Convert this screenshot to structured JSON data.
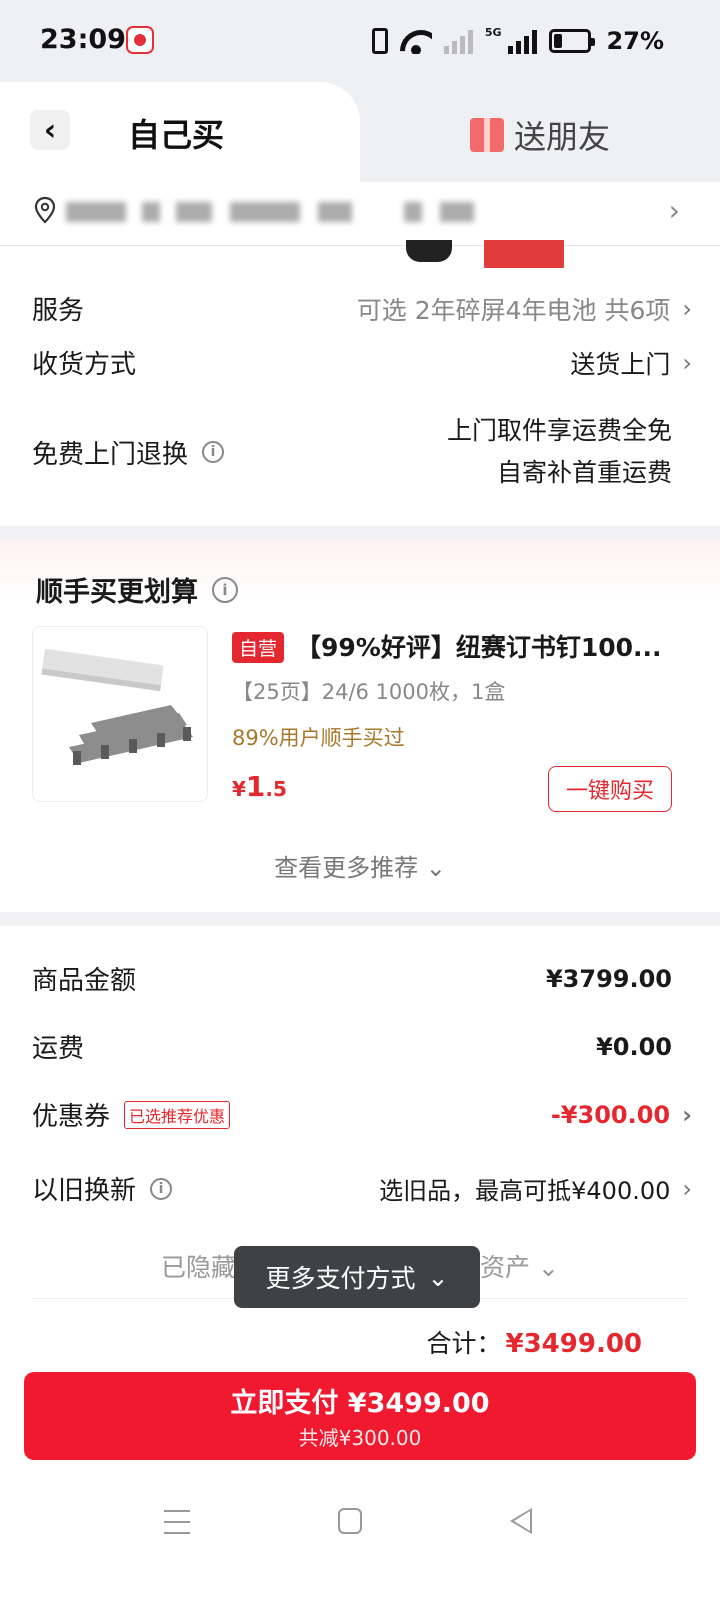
{
  "status_bar": {
    "time": "23:09",
    "network": "5G",
    "battery": "27%"
  },
  "header": {
    "tab_self": "自己买",
    "tab_gift": "送朋友"
  },
  "details": {
    "service_label": "服务",
    "service_value": "可选 2年碎屏4年电池 共6项",
    "delivery_label": "收货方式",
    "delivery_value": "送货上门",
    "return_label": "免费上门退换",
    "return_value_1": "上门取件享运费全免",
    "return_value_2": "自寄补首重运费"
  },
  "recommend": {
    "title": "顺手买更划算",
    "self_tag": "自营",
    "product_name": "【99%好评】纽赛订书钉100...",
    "spec": "【25页】24/6 1000枚，1盒",
    "hint": "89%用户顺手买过",
    "price_currency": "¥",
    "price_int": "1",
    "price_dec": ".5",
    "buy_button": "一键购买",
    "more": "查看更多推荐"
  },
  "summary": {
    "goods_label": "商品金额",
    "goods_value": "¥3799.00",
    "shipping_label": "运费",
    "shipping_value": "¥0.00",
    "coupon_label": "优惠券",
    "coupon_tag": "已选推荐优惠",
    "coupon_value": "-¥300.00",
    "tradein_label": "以旧换新",
    "tradein_value": "选旧品，最高可抵¥400.00",
    "hidden_left": "已隐藏",
    "hidden_right": "资产",
    "total_label": "合计：",
    "total_value": "¥3499.00"
  },
  "toast": {
    "text": "更多支付方式"
  },
  "pay": {
    "main": "立即支付 ¥3499.00",
    "sub": "共减¥300.00"
  },
  "colors": {
    "accent": "#f0192f",
    "price_red": "#e5282f",
    "hint_gold": "#a8782b"
  }
}
